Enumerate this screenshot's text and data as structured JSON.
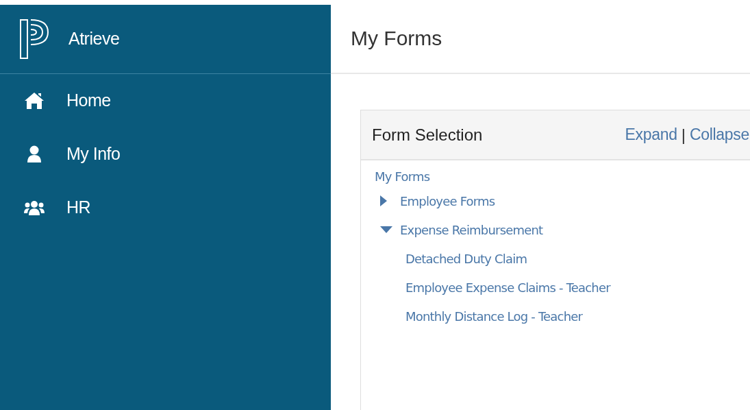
{
  "sidebar": {
    "brand": "Atrieve",
    "items": [
      {
        "kind": "home",
        "label": "Home"
      },
      {
        "kind": "user",
        "label": "My Info"
      },
      {
        "kind": "group",
        "label": "HR"
      }
    ]
  },
  "page_title": "My Forms",
  "panel": {
    "title": "Form Selection",
    "actions": [
      "Expand",
      "Collapse"
    ],
    "separator": "|",
    "tree": [
      {
        "label": "My Forms",
        "children": [
          {
            "label": "Employee Forms",
            "expanded": false
          },
          {
            "label": "Expense Reimbursement",
            "expanded": true,
            "children": [
              {
                "label": "Detached Duty Claim"
              },
              {
                "label": "Employee Expense Claims - Teacher"
              },
              {
                "label": "Monthly Distance Log - Teacher"
              }
            ]
          }
        ]
      }
    ]
  }
}
